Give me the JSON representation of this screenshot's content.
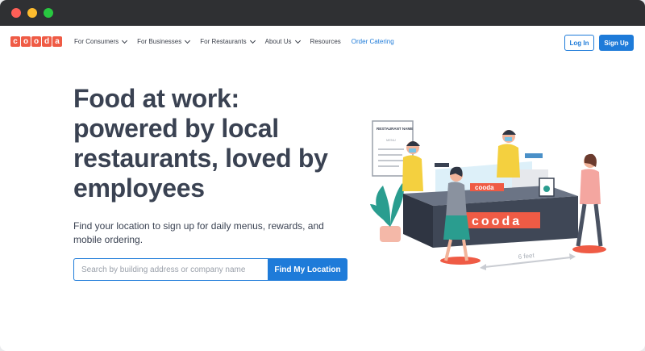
{
  "brand": {
    "logo_letters": [
      "c",
      "o",
      "o",
      "d",
      "a"
    ]
  },
  "nav": {
    "items": [
      {
        "label": "For Consumers",
        "has_dropdown": true
      },
      {
        "label": "For Businesses",
        "has_dropdown": true
      },
      {
        "label": "For Restaurants",
        "has_dropdown": true
      },
      {
        "label": "About Us",
        "has_dropdown": true
      },
      {
        "label": "Resources",
        "has_dropdown": false
      },
      {
        "label": "Order Catering",
        "has_dropdown": false
      }
    ],
    "login_label": "Log In",
    "signup_label": "Sign Up"
  },
  "hero": {
    "headline_lines": [
      "Food at work:",
      "powered by local",
      "restaurants, loved by",
      "employees"
    ],
    "subtext": "Find your location to sign up for daily menus, rewards, and mobile ordering.",
    "search_placeholder": "Search by building address or company name",
    "search_button": "Find My Location"
  },
  "illustration": {
    "menu_sign_title": "RESTAURANT NAME",
    "menu_sign_sub": "MENU",
    "counter_logo": "cooda",
    "distance_label": "6 feet"
  },
  "colors": {
    "accent": "#1e7bd9",
    "brand": "#ef5b45",
    "text": "#3a4252",
    "titlebar": "#2f3033"
  }
}
